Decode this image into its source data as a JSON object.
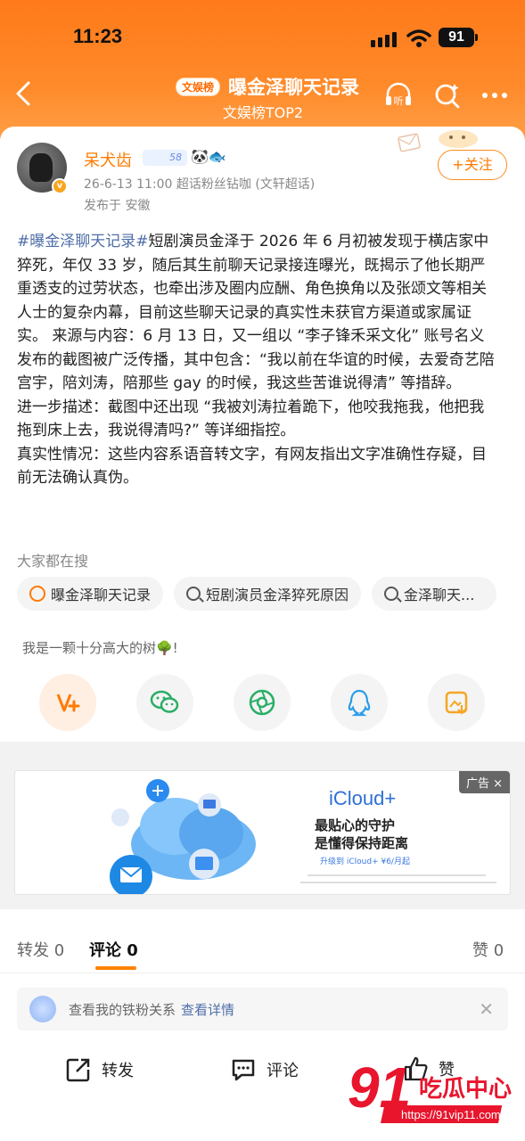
{
  "status_bar": {
    "time": "11:23",
    "battery": "91"
  },
  "header": {
    "badge": "文娱榜",
    "title": "曝金泽聊天记录",
    "subtitle": "文娱榜TOP2",
    "icons": [
      "back-icon",
      "listen-icon",
      "search-sparkle-icon",
      "more-icon"
    ],
    "listen_label": "听"
  },
  "post": {
    "author": "呆犬齿",
    "level": "58",
    "time_meta": "26-6-13 11:00  超话粉丝钻咖 (文轩超话)",
    "location": "发布于 安徽",
    "follow_label": "+关注",
    "hashtag": "#曝金泽聊天记录#",
    "body_1": "短剧演员金泽于 2026 年 6 月初被发现于横店家中猝死，年仅 33 岁，随后其生前聊天记录接连曝光，既揭示了他长期严重透支的过劳状态，也牵出涉及圈内应酬、角色换角以及张颂文等相关人士的复杂内幕，目前这些聊天记录的真实性未获官方渠道或家属证实。 来源与内容：6 月 13 日，又一组以 “李子锋禾采文化” 账号名义发布的截图被广泛传播，其中包含：“我以前在华谊的时候，去爱奇艺陪宫宇，陪刘涛，陪那些 gay 的时候，我这些苦谁说得清” 等措辞。",
    "body_2": "进一步描述：截图中还出现 “我被刘涛拉着跪下，他咬我拖我，他把我拖到床上去，我说得清吗?” 等详细指控。",
    "body_3": "真实性情况：这些内容系语音转文字，有网友指出文字准确性存疑，目前无法确认真伪。"
  },
  "search": {
    "heading": "大家都在搜",
    "chips": [
      "曝金泽聊天记录",
      "短剧演员金泽猝死原因",
      "金泽聊天..."
    ]
  },
  "tree_text": "我是一颗十分高大的树🌳!",
  "share_icons": [
    "weibo-repost-icon",
    "wechat-icon",
    "moments-icon",
    "qq-icon",
    "save-image-icon"
  ],
  "ad": {
    "label": "广告 ×",
    "brand": "iCloud+",
    "line1": "最贴心的守护",
    "line2": "是懂得保持距离",
    "small": "升级到 iCloud+ ¥6/月起"
  },
  "comments": {
    "tab_repost": "转发 0",
    "tab_comment": "评论 0",
    "tab_like": "赞 0",
    "fans_text": "查看我的铁粉关系",
    "fans_link": "查看详情"
  },
  "actions": {
    "repost": "转发",
    "comment": "评论",
    "like": "赞"
  },
  "watermark": {
    "brand": "91吃瓜中心",
    "url": "https://91vip11.com"
  },
  "colors": {
    "accent": "#ff7a00",
    "header_top": "#ff7a1a",
    "link": "#4f6ea8"
  }
}
